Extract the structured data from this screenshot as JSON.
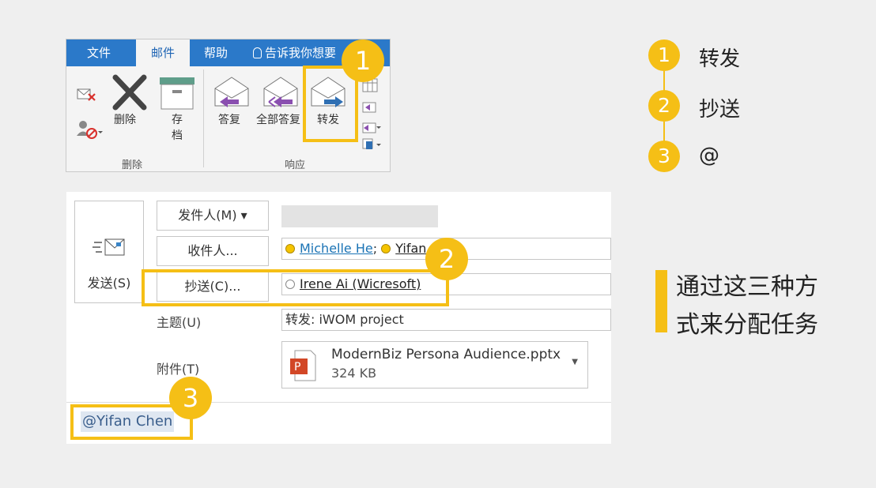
{
  "ribbon": {
    "tabs": [
      {
        "label": "文件",
        "active": false
      },
      {
        "label": "邮件",
        "active": true
      },
      {
        "label": "帮助",
        "active": false
      }
    ],
    "tell_me": "告诉我你想要",
    "buttons": {
      "delete": "删除",
      "archive": "存\n档",
      "reply": "答复",
      "reply_all": "全部答复",
      "forward": "转发"
    },
    "groups": {
      "delete": "删除",
      "respond": "响应"
    }
  },
  "compose": {
    "send": "发送(S)",
    "from_button": "发件人(M) ▾",
    "to_button": "收件人...",
    "cc_button": "抄送(C)...",
    "to_recipients": [
      {
        "name": "Michelle He",
        "status": "away"
      },
      {
        "name": "Yifan Chen",
        "status": "away"
      }
    ],
    "cc_recipients": [
      {
        "name": "Irene Ai (Wicresoft)",
        "status": "offline"
      }
    ],
    "subject_label": "主题(U)",
    "subject_value": "转发: iWOM project",
    "attachment_label": "附件(T)",
    "attachment": {
      "name": "ModernBiz Persona Audience.pptx",
      "size": "324 KB"
    },
    "body_mention": "@Yifan Chen"
  },
  "badges": [
    "1",
    "2",
    "3"
  ],
  "legend": [
    {
      "num": "1",
      "label": "转发"
    },
    {
      "num": "2",
      "label": "抄送"
    },
    {
      "num": "3",
      "label": "@"
    }
  ],
  "note": {
    "line1": "通过这三种方",
    "line2": "式来分配任务"
  },
  "colors": {
    "accent": "#f5bf16",
    "tabbar": "#2b79c9",
    "link": "#1a73b5"
  }
}
